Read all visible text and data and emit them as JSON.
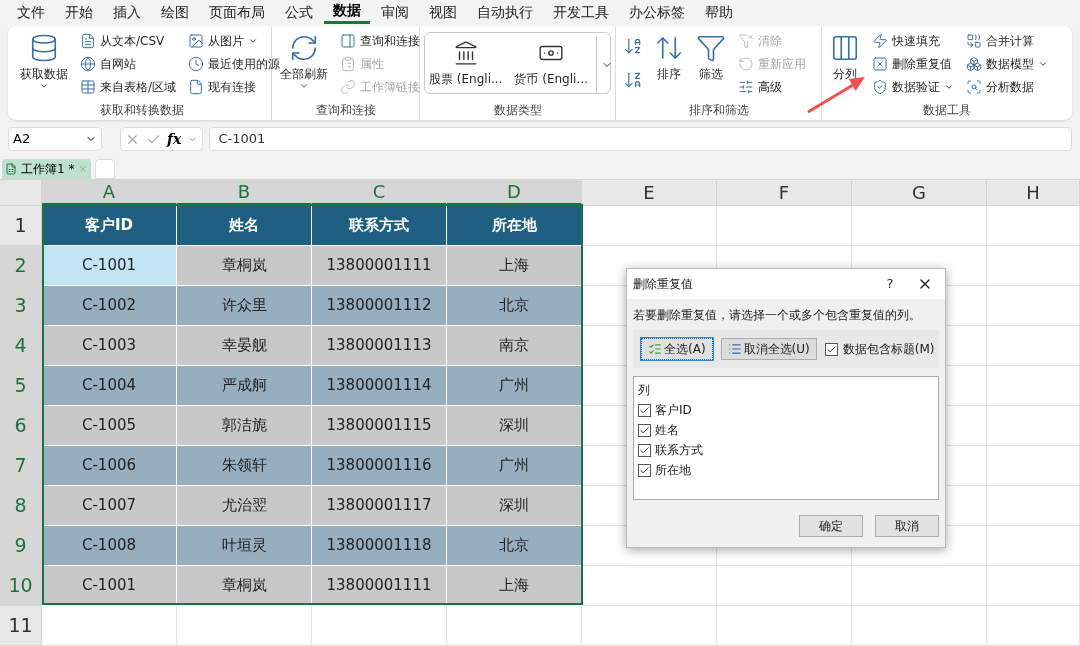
{
  "menu_tabs": [
    {
      "label": "文件",
      "selected": false
    },
    {
      "label": "开始",
      "selected": false
    },
    {
      "label": "插入",
      "selected": false
    },
    {
      "label": "绘图",
      "selected": false
    },
    {
      "label": "页面布局",
      "selected": false
    },
    {
      "label": "公式",
      "selected": false
    },
    {
      "label": "数据",
      "selected": true
    },
    {
      "label": "审阅",
      "selected": false
    },
    {
      "label": "视图",
      "selected": false
    },
    {
      "label": "自动执行",
      "selected": false
    },
    {
      "label": "开发工具",
      "selected": false
    },
    {
      "label": "办公标签",
      "selected": false
    },
    {
      "label": "帮助",
      "selected": false
    }
  ],
  "ribbon": {
    "groups": [
      {
        "label": "获取和转换数据",
        "columns": [
          [
            {
              "kind": "large",
              "label": "获取数据",
              "dropdown": true,
              "disabled": false
            }
          ],
          [
            {
              "kind": "small",
              "label": "从文本/CSV",
              "dropdown": false,
              "disabled": false
            },
            {
              "kind": "small",
              "label": "自网站",
              "dropdown": false,
              "disabled": false
            },
            {
              "kind": "small",
              "label": "来自表格/区域",
              "dropdown": false,
              "disabled": false
            }
          ],
          [
            {
              "kind": "small",
              "label": "从图片",
              "dropdown": true,
              "disabled": false
            },
            {
              "kind": "small",
              "label": "最近使用的源",
              "dropdown": false,
              "disabled": false
            },
            {
              "kind": "small",
              "label": "现有连接",
              "dropdown": false,
              "disabled": false
            }
          ]
        ]
      },
      {
        "label": "查询和连接",
        "columns": [
          [
            {
              "kind": "large",
              "label": "全部刷新",
              "dropdown": true,
              "disabled": false
            }
          ],
          [
            {
              "kind": "small",
              "label": "查询和连接",
              "dropdown": false,
              "disabled": false
            },
            {
              "kind": "small",
              "label": "属性",
              "dropdown": false,
              "disabled": true
            },
            {
              "kind": "small",
              "label": "工作簿链接",
              "dropdown": false,
              "disabled": true
            }
          ]
        ]
      },
      {
        "label": "数据类型",
        "columns": [
          [
            {
              "kind": "gallery",
              "label": "股票 (Engli...",
              "dropdown": false,
              "disabled": false
            }
          ],
          [
            {
              "kind": "gallery",
              "label": "货币 (Engli...",
              "dropdown": false,
              "disabled": false
            }
          ],
          [
            {
              "kind": "more",
              "dropdown": true,
              "disabled": false
            }
          ]
        ]
      },
      {
        "label": "排序和筛选",
        "columns": [
          [
            {
              "kind": "iconbutton",
              "dropdown": false,
              "disabled": false
            },
            {
              "kind": "iconbutton",
              "dropdown": false,
              "disabled": false
            }
          ],
          [
            {
              "kind": "large",
              "label": "排序",
              "dropdown": false,
              "disabled": false
            }
          ],
          [
            {
              "kind": "large",
              "label": "筛选",
              "dropdown": false,
              "disabled": false
            }
          ],
          [
            {
              "kind": "small",
              "label": "清除",
              "dropdown": false,
              "disabled": true
            },
            {
              "kind": "small",
              "label": "重新应用",
              "dropdown": false,
              "disabled": true
            },
            {
              "kind": "small",
              "label": "高级",
              "dropdown": false,
              "disabled": false
            }
          ]
        ]
      },
      {
        "label": "数据工具",
        "columns": [
          [
            {
              "kind": "large",
              "label": "分列",
              "dropdown": false,
              "disabled": false
            }
          ],
          [
            {
              "kind": "small",
              "label": "快速填充",
              "dropdown": false,
              "disabled": false
            },
            {
              "kind": "small",
              "label": "删除重复值",
              "dropdown": false,
              "disabled": false
            },
            {
              "kind": "small",
              "label": "数据验证",
              "dropdown": true,
              "disabled": false
            }
          ],
          [
            {
              "kind": "small",
              "label": "合并计算",
              "dropdown": false,
              "disabled": false
            },
            {
              "kind": "small",
              "label": "数据模型",
              "dropdown": true,
              "disabled": false
            },
            {
              "kind": "small",
              "label": "分析数据",
              "dropdown": false,
              "disabled": false
            }
          ]
        ]
      }
    ]
  },
  "formula_bar": {
    "name_box": "A2",
    "fx": "fx",
    "value": "C-1001"
  },
  "workbook_tab": {
    "label": "工作簿1 *",
    "selected": true
  },
  "sheet": {
    "columns": [
      "A",
      "B",
      "C",
      "D",
      "E",
      "F",
      "G",
      "H"
    ],
    "row_numbers": [
      "1",
      "2",
      "3",
      "4",
      "5",
      "6",
      "7",
      "8",
      "9",
      "10",
      "11"
    ],
    "header": [
      "客户ID",
      "姓名",
      "联系方式",
      "所在地"
    ],
    "rows": [
      {
        "cells": [
          {
            "text": "C-1001",
            "selected": true
          },
          {
            "text": "章桐岚",
            "selected": false
          },
          {
            "text": "13800001111",
            "selected": false
          },
          {
            "text": "上海",
            "selected": false
          }
        ]
      },
      {
        "cells": [
          {
            "text": "C-1002",
            "selected": false
          },
          {
            "text": "许众里",
            "selected": false
          },
          {
            "text": "13800001112",
            "selected": false
          },
          {
            "text": "北京",
            "selected": false
          }
        ]
      },
      {
        "cells": [
          {
            "text": "C-1003",
            "selected": false
          },
          {
            "text": "幸晏舰",
            "selected": false
          },
          {
            "text": "13800001113",
            "selected": false
          },
          {
            "text": "南京",
            "selected": false
          }
        ]
      },
      {
        "cells": [
          {
            "text": "C-1004",
            "selected": false
          },
          {
            "text": "严成舸",
            "selected": false
          },
          {
            "text": "13800001114",
            "selected": false
          },
          {
            "text": "广州",
            "selected": false
          }
        ]
      },
      {
        "cells": [
          {
            "text": "C-1005",
            "selected": false
          },
          {
            "text": "郭洁旎",
            "selected": false
          },
          {
            "text": "13800001115",
            "selected": false
          },
          {
            "text": "深圳",
            "selected": false
          }
        ]
      },
      {
        "cells": [
          {
            "text": "C-1006",
            "selected": false
          },
          {
            "text": "朱领轩",
            "selected": false
          },
          {
            "text": "13800001116",
            "selected": false
          },
          {
            "text": "广州",
            "selected": false
          }
        ]
      },
      {
        "cells": [
          {
            "text": "C-1007",
            "selected": false
          },
          {
            "text": "尤治翌",
            "selected": false
          },
          {
            "text": "13800001117",
            "selected": false
          },
          {
            "text": "深圳",
            "selected": false
          }
        ]
      },
      {
        "cells": [
          {
            "text": "C-1008",
            "selected": false
          },
          {
            "text": "叶垣灵",
            "selected": false
          },
          {
            "text": "13800001118",
            "selected": false
          },
          {
            "text": "北京",
            "selected": false
          }
        ]
      },
      {
        "cells": [
          {
            "text": "C-1001",
            "selected": false
          },
          {
            "text": "章桐岚",
            "selected": false
          },
          {
            "text": "13800001111",
            "selected": false
          },
          {
            "text": "上海",
            "selected": false
          }
        ]
      }
    ]
  },
  "dialog": {
    "title": "删除重复值",
    "help": "?",
    "instruction": "若要删除重复值，请选择一个或多个包含重复值的列。",
    "select_all": "全选(A)",
    "unselect_all": "取消全选(U)",
    "has_headers": {
      "label": "数据包含标题(M)",
      "checked": true
    },
    "list_header": "列",
    "columns": [
      {
        "label": "客户ID",
        "checked": true
      },
      {
        "label": "姓名",
        "checked": true
      },
      {
        "label": "联系方式",
        "checked": true
      },
      {
        "label": "所在地",
        "checked": true
      }
    ],
    "ok": "确定",
    "cancel": "取消"
  }
}
